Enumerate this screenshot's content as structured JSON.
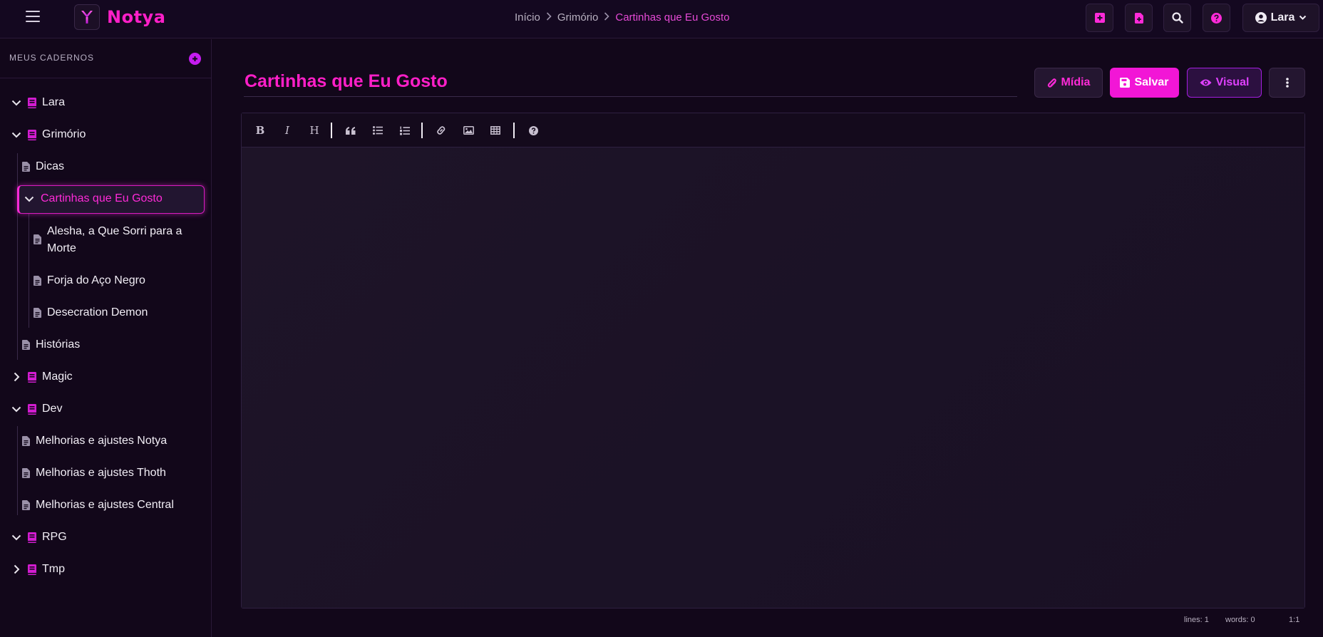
{
  "app": {
    "name": "Notya"
  },
  "breadcrumb": {
    "items": [
      "Início",
      "Grimório"
    ],
    "current": "Cartinhas que Eu Gosto"
  },
  "user": {
    "name": "Lara"
  },
  "sidebar": {
    "title": "MEUS CADERNOS",
    "tree": {
      "lara": "Lara",
      "grimorio": "Grimório",
      "dicas": "Dicas",
      "cartinhas": "Cartinhas que Eu Gosto",
      "alesha_line1": "Alesha, a Que Sorri para a",
      "alesha_line2": "Morte",
      "forja": "Forja do Aço Negro",
      "desecration": "Desecration Demon",
      "historias": "Histórias",
      "magic": "Magic",
      "dev": "Dev",
      "notya": "Melhorias e ajustes Notya",
      "thoth": "Melhorias e ajustes Thoth",
      "central": "Melhorias e ajustes Central",
      "rpg": "RPG",
      "tmp": "Tmp"
    }
  },
  "document": {
    "title": "Cartinhas que Eu Gosto"
  },
  "actions": {
    "midia": "Mídia",
    "salvar": "Salvar",
    "visual": "Visual"
  },
  "toolbar": {
    "bold": "B",
    "italic": "I",
    "heading": "H"
  },
  "status": {
    "lines": "lines: 1",
    "words": "words: 0",
    "cursor": "1:1"
  },
  "colors": {
    "accent": "#ff1fc8",
    "background": "#12071a",
    "notebook_icon": "#d21cd0"
  }
}
